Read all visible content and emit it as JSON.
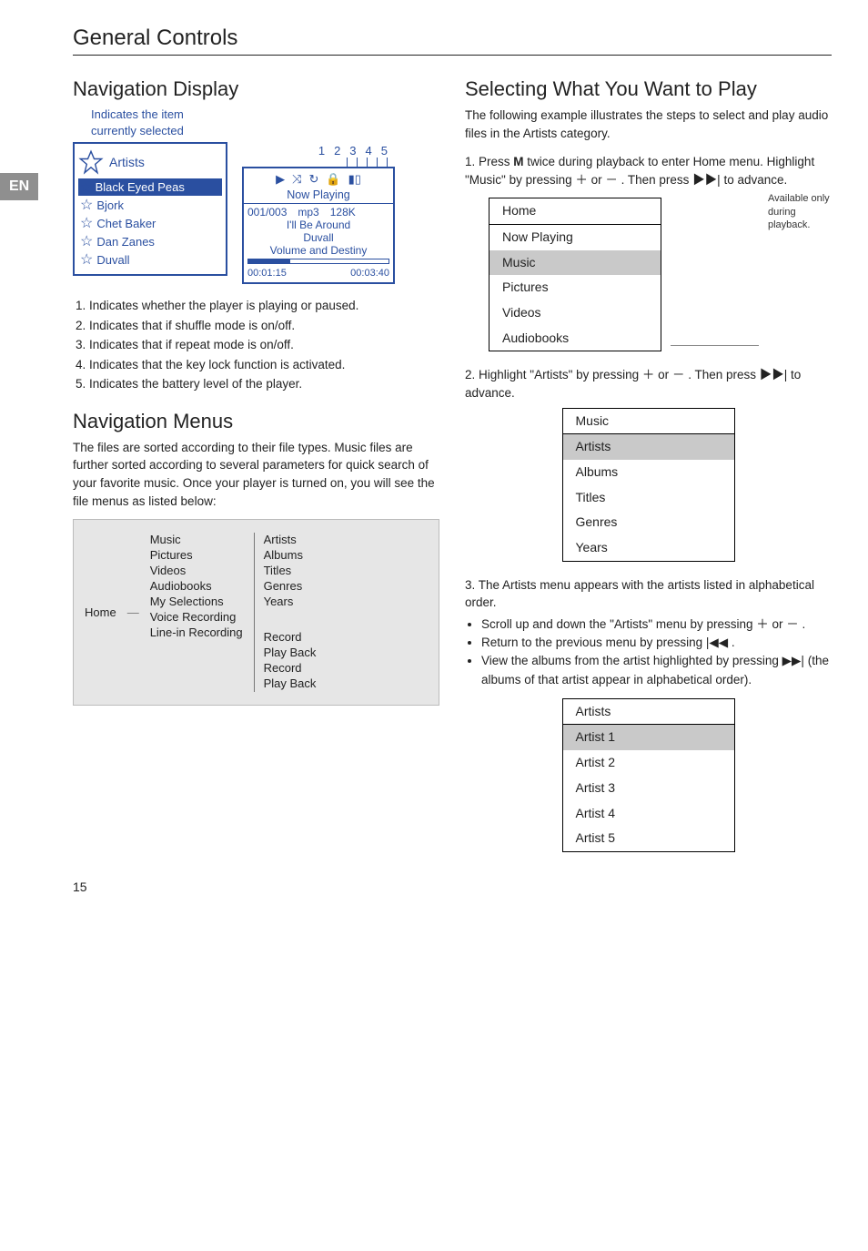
{
  "page_number": "15",
  "lang_tab": "EN",
  "section_title": "General Controls",
  "left": {
    "nav_display_h": "Navigation Display",
    "indicates_item": "Indicates the item\ncurrently selected",
    "legend_numbers": [
      "1",
      "2",
      "3",
      "4",
      "5"
    ],
    "artist_box": {
      "heading": "Artists",
      "items": [
        {
          "label": "Black Eyed Peas",
          "selected": true,
          "star": "solid"
        },
        {
          "label": "Bjork",
          "selected": false,
          "star": "outline"
        },
        {
          "label": "Chet Baker",
          "selected": false,
          "star": "outline"
        },
        {
          "label": "Dan Zanes",
          "selected": false,
          "star": "outline"
        },
        {
          "label": "Duvall",
          "selected": false,
          "star": "outline"
        }
      ]
    },
    "now_playing": {
      "title": "Now Playing",
      "track_info": "001/003 mp3 128K",
      "song": "I'll Be Around",
      "artist": "Duvall",
      "album": "Volume and Destiny",
      "elapsed": "00:01:15",
      "total": "00:03:40"
    },
    "legend_items": [
      "Indicates whether the player is playing or paused.",
      "Indicates that if shuffle mode is on/off.",
      "Indicates that if repeat mode is on/off.",
      "Indicates that the key lock function is activated.",
      "Indicates the battery level of the player."
    ],
    "nav_menus_h": "Navigation Menus",
    "nav_menus_body": "The files are sorted according to their file types. Music files are further sorted according to several parameters for quick search of your favorite music. Once your player is turned on, you will see the file menus as listed below:",
    "diagram": {
      "root": "Home",
      "level2": [
        "Music",
        "Pictures",
        "Videos",
        "Audiobooks",
        "My Selections",
        "Voice Recording",
        "Line-in Recording"
      ],
      "music_children": [
        "Artists",
        "Albums",
        "Titles",
        "Genres",
        "Years"
      ],
      "voice_children": [
        "Record",
        "Play Back"
      ],
      "linein_children": [
        "Record",
        "Play Back"
      ]
    }
  },
  "right": {
    "selecting_h": "Selecting What You Want to Play",
    "selecting_body": "The following example illustrates the steps to select and play audio files in the Artists category.",
    "step1_a": "Press ",
    "step1_b": " twice during playback to enter Home menu. Highlight \"Music\" by pressing ",
    "step1_key": "M",
    "step1_c": " or ",
    "step1_d": " . Then press ",
    "step1_e": " to advance.",
    "side_note": "Available only during playback.",
    "home_menu": {
      "header": "Home",
      "items": [
        "Now Playing",
        "Music",
        "Pictures",
        "Videos",
        "Audiobooks"
      ],
      "selected": "Music"
    },
    "step2_a": "Highlight \"Artists\" by pressing ",
    "step2_b": " or ",
    "step2_c": " . Then press ",
    "step2_d": " to advance.",
    "music_menu": {
      "header": "Music",
      "items": [
        "Artists",
        "Albums",
        "Titles",
        "Genres",
        "Years"
      ],
      "selected": "Artists"
    },
    "step3": "The Artists menu appears with the artists listed in alphabetical order.",
    "bullets": {
      "b1_a": "Scroll up and down the \"Artists\" menu by pressing ",
      "b1_b": " or ",
      "b1_c": " .",
      "b2_a": "Return to the previous menu by pressing ",
      "b2_b": " .",
      "b3_a": "View the albums from the artist highlighted by pressing ",
      "b3_b": " (the albums of that artist appear in alphabetical order)."
    },
    "artists_menu": {
      "header": "Artists",
      "items": [
        "Artist 1",
        "Artist 2",
        "Artist 3",
        "Artist 4",
        "Artist 5"
      ],
      "selected": "Artist 1"
    }
  },
  "glyphs": {
    "play": "▶",
    "shuffle": "⤨",
    "repeat": "↻",
    "lock": "🔒",
    "battery": "▮▯",
    "plus": "＋",
    "minus": "－",
    "next": "▶▶|",
    "prev": "|◀◀"
  }
}
